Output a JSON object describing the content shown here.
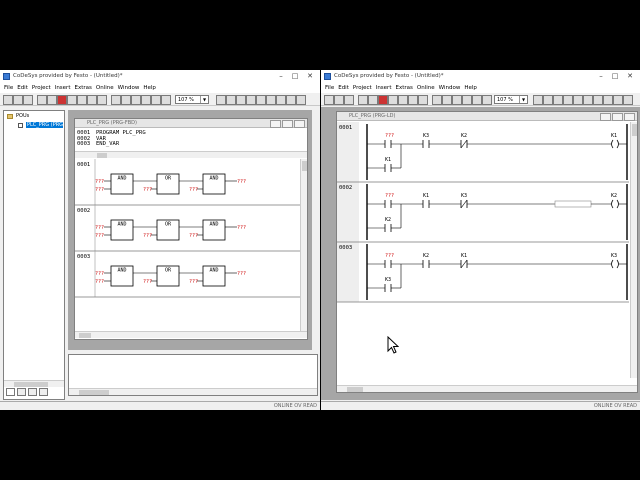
{
  "app_title": "CoDeSys provided by Festo - (Untitled)*",
  "menu": [
    "File",
    "Edit",
    "Project",
    "Insert",
    "Extras",
    "Online",
    "Window",
    "Help"
  ],
  "zoom": "107 %",
  "status": "ONLINE  OV  READ",
  "left": {
    "pou_tree": {
      "root": "POUs",
      "item": "PLC_PRG (PRG)"
    },
    "editor_title": "PLC_PRG (PRG-FBD)",
    "decl_lines": [
      {
        "num": "0001",
        "text": "PROGRAM PLC_PRG"
      },
      {
        "num": "0002",
        "text": "VAR"
      },
      {
        "num": "0003",
        "text": "END_VAR"
      }
    ],
    "networks": [
      {
        "num": "0001",
        "blocks": [
          "AND",
          "OR",
          "AND"
        ],
        "in": "???",
        "out": "???"
      },
      {
        "num": "0002",
        "blocks": [
          "AND",
          "OR",
          "AND"
        ],
        "in": "???",
        "out": "???"
      },
      {
        "num": "0003",
        "blocks": [
          "AND",
          "OR",
          "AND"
        ],
        "in": "???",
        "out": "???"
      }
    ]
  },
  "right": {
    "editor_title": "PLC_PRG (PRG-LD)",
    "rungs": [
      {
        "num": "0001",
        "c1": "???",
        "c2": "K3",
        "c3": "K2",
        "coil": "K1",
        "branch": "K1",
        "c3_nc": true,
        "placeholder": false
      },
      {
        "num": "0002",
        "c1": "???",
        "c2": "K1",
        "c3": "K3",
        "coil": "K2",
        "branch": "K2",
        "c3_nc": true,
        "placeholder": true
      },
      {
        "num": "0003",
        "c1": "???",
        "c2": "K2",
        "c3": "K1",
        "coil": "K3",
        "branch": "K3",
        "c3_nc": true,
        "placeholder": false
      }
    ]
  }
}
